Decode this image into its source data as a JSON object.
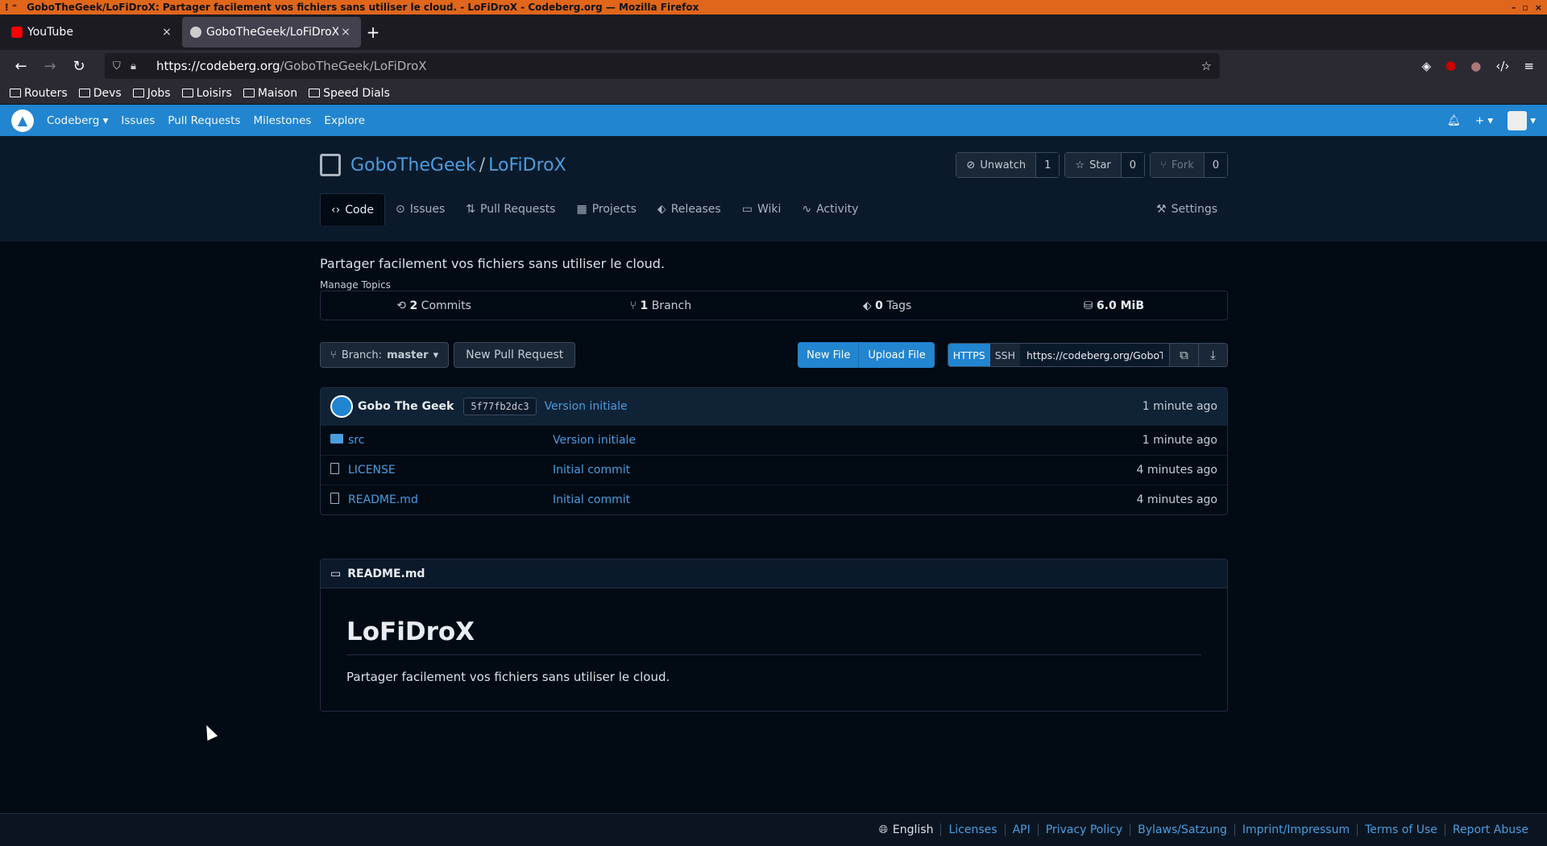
{
  "window": {
    "title": "GoboTheGeek/LoFiDroX: Partager facilement vos fichiers sans utiliser le cloud. - LoFiDroX - Codeberg.org — Mozilla Firefox"
  },
  "browser": {
    "tabs": [
      {
        "label": "YouTube",
        "close": "×"
      },
      {
        "label": "GoboTheGeek/LoFiDroX:",
        "close": "×"
      }
    ],
    "new_tab": "+",
    "url_domain": "https://codeberg.org",
    "url_path": "/GoboTheGeek/LoFiDroX",
    "bookmarks": [
      "Routers",
      "Devs",
      "Jobs",
      "Loisirs",
      "Maison",
      "Speed Dials"
    ]
  },
  "site_nav": {
    "brand": "Codeberg",
    "items": [
      "Issues",
      "Pull Requests",
      "Milestones",
      "Explore"
    ]
  },
  "repo": {
    "owner": "GoboTheGeek",
    "separator": "/",
    "name": "LoFiDroX",
    "watch": {
      "label": "Unwatch",
      "count": "1"
    },
    "star": {
      "label": "Star",
      "count": "0"
    },
    "fork": {
      "label": "Fork",
      "count": "0"
    },
    "tabs": {
      "code": "Code",
      "issues": "Issues",
      "pulls": "Pull Requests",
      "projects": "Projects",
      "releases": "Releases",
      "wiki": "Wiki",
      "activity": "Activity",
      "settings": "Settings"
    },
    "description": "Partager facilement vos fichiers sans utiliser le cloud.",
    "manage_topics": "Manage Topics",
    "stats": {
      "commits_num": "2",
      "commits_label": "Commits",
      "branch_num": "1",
      "branch_label": "Branch",
      "tags_num": "0",
      "tags_label": "Tags",
      "size": "6.0 MiB"
    },
    "toolbar": {
      "branch_prefix": "Branch:",
      "branch": "master",
      "new_pr": "New Pull Request",
      "new_file": "New File",
      "upload_file": "Upload File",
      "https": "HTTPS",
      "ssh": "SSH",
      "clone_url": "https://codeberg.org/GoboTheGeek/LoFiDroX.git"
    },
    "latest_commit": {
      "author": "Gobo The Geek",
      "sha": "5f77fb2dc3",
      "message": "Version initiale",
      "time": "1 minute ago"
    },
    "files": [
      {
        "name": "src",
        "message": "Version initiale",
        "time": "1 minute ago",
        "type": "dir"
      },
      {
        "name": "LICENSE",
        "message": "Initial commit",
        "time": "4 minutes ago",
        "type": "file"
      },
      {
        "name": "README.md",
        "message": "Initial commit",
        "time": "4 minutes ago",
        "type": "file"
      }
    ],
    "readme": {
      "filename": "README.md",
      "heading": "LoFiDroX",
      "body": "Partager facilement vos fichiers sans utiliser le cloud."
    }
  },
  "footer": {
    "language": "English",
    "links": [
      "Licenses",
      "API",
      "Privacy Policy",
      "Bylaws/Satzung",
      "Imprint/Impressum",
      "Terms of Use",
      "Report Abuse"
    ]
  }
}
